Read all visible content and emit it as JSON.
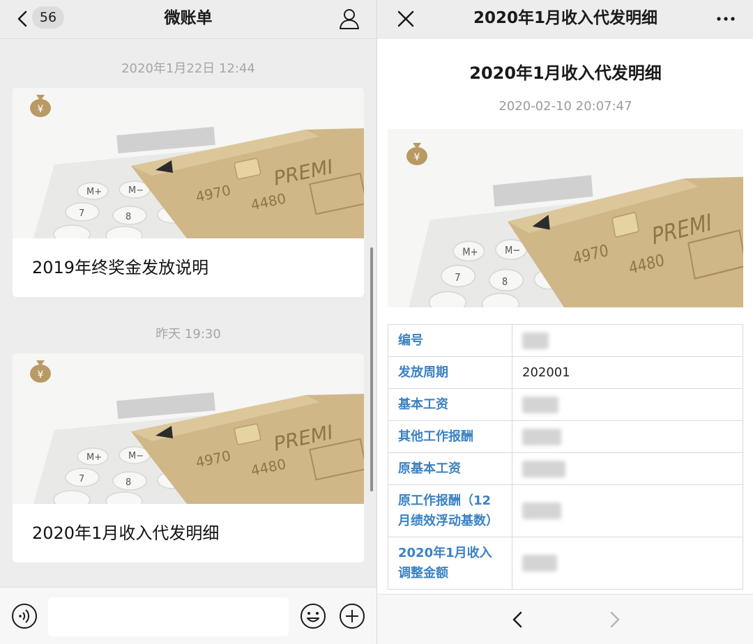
{
  "left": {
    "header": {
      "badge": "56",
      "title": "微账单"
    },
    "messages": [
      {
        "timestamp": "2020年1月22日 12:44",
        "title": "2019年终奖金发放说明"
      },
      {
        "timestamp": "昨天 19:30",
        "title": "2020年1月收入代发明细"
      }
    ]
  },
  "right": {
    "header": {
      "title": "2020年1月收入代发明细"
    },
    "article": {
      "title": "2020年1月收入代发明细",
      "date": "2020-02-10 20:07:47"
    },
    "rows": [
      {
        "label": "编号",
        "value": ""
      },
      {
        "label": "发放周期",
        "value": "202001"
      },
      {
        "label": "基本工资",
        "value": ""
      },
      {
        "label": "其他工作报酬",
        "value": ""
      },
      {
        "label": "原基本工资",
        "value": ""
      },
      {
        "label": "原工作报酬（12月绩效浮动基数）",
        "value": ""
      },
      {
        "label": "2020年1月收入调整金额",
        "value": ""
      }
    ]
  },
  "colors": {
    "accent_label": "#3b82c4",
    "gold_icon": "#b99a64",
    "background": "#ededed"
  },
  "icons": [
    "back-icon",
    "person-icon",
    "voice-icon",
    "emoji-icon",
    "plus-icon",
    "close-icon",
    "more-icon",
    "yen-bag-icon",
    "nav-back-icon",
    "nav-forward-icon"
  ]
}
